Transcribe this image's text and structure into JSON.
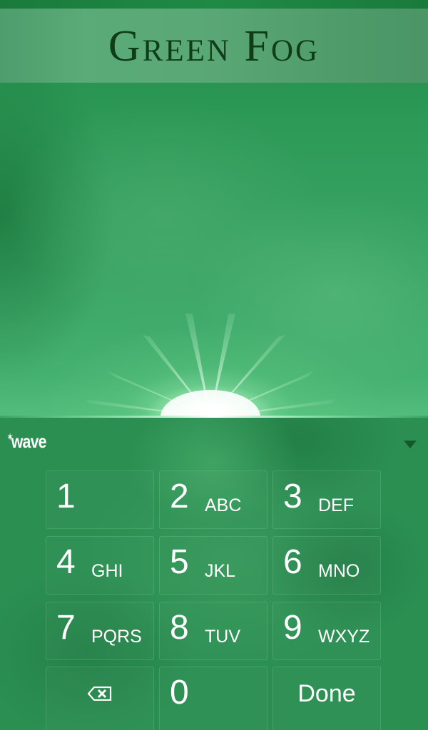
{
  "theme": {
    "title": "Green Fog",
    "colors": {
      "title_text": "#0f3d17",
      "title_bar": "#5aab77",
      "background": "#2e9a58",
      "key_text": "#ffffff",
      "collapse_icon": "#13592a"
    }
  },
  "keyboard": {
    "brand": "wave",
    "brand_icon": "spark-icon",
    "collapse_icon": "chevron-down-icon",
    "keys": [
      {
        "digit": "1",
        "letters": ""
      },
      {
        "digit": "2",
        "letters": "ABC"
      },
      {
        "digit": "3",
        "letters": "DEF"
      },
      {
        "digit": "4",
        "letters": "GHI"
      },
      {
        "digit": "5",
        "letters": "JKL"
      },
      {
        "digit": "6",
        "letters": "MNO"
      },
      {
        "digit": "7",
        "letters": "PQRS"
      },
      {
        "digit": "8",
        "letters": "TUV"
      },
      {
        "digit": "9",
        "letters": "WXYZ"
      },
      {
        "digit": "0",
        "letters": ""
      }
    ],
    "backspace_icon": "backspace-icon",
    "done_label": "Done"
  }
}
